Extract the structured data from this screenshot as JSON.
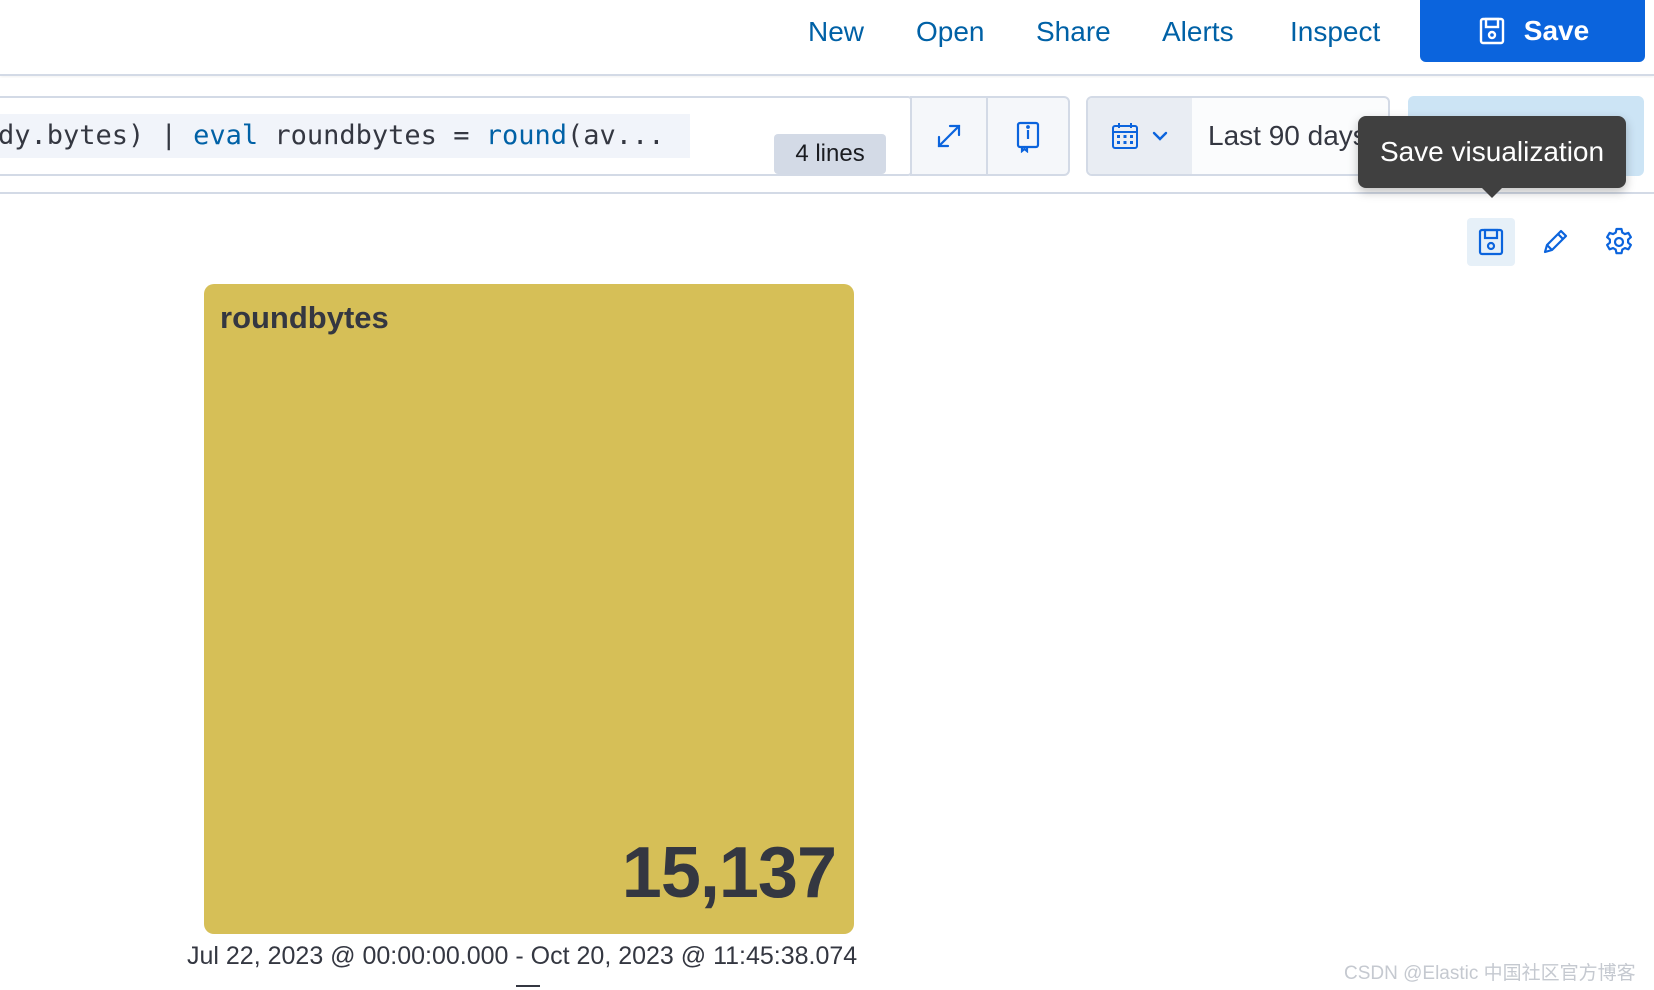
{
  "topnav": {
    "links": [
      "New",
      "Open",
      "Share",
      "Alerts",
      "Inspect"
    ],
    "save_label": "Save"
  },
  "query": {
    "code_parts": [
      {
        "text": "dy.bytes)",
        "kind": "plain"
      },
      {
        "text": " | ",
        "kind": "plain"
      },
      {
        "text": "eval",
        "kind": "kw"
      },
      {
        "text": " roundbytes = ",
        "kind": "plain"
      },
      {
        "text": "round",
        "kind": "kw"
      },
      {
        "text": "(av...",
        "kind": "plain"
      }
    ],
    "lines_badge": "4 lines",
    "expand_icon": "expand-icon",
    "docs_icon": "book-icon"
  },
  "datepicker": {
    "calendar_icon": "calendar-icon",
    "range_label": "Last 90 days"
  },
  "tooltip": {
    "text": "Save visualization"
  },
  "panel_toolbar": {
    "icons": [
      "save-icon",
      "pencil-icon",
      "gear-icon"
    ]
  },
  "metric": {
    "title": "roundbytes",
    "value": "15,137",
    "background_color": "#d6bf57",
    "time_range": "Jul 22, 2023 @ 00:00:00.000 - Oct 20, 2023 @ 11:45:38.074"
  },
  "watermark": "CSDN @Elastic 中国社区官方博客"
}
